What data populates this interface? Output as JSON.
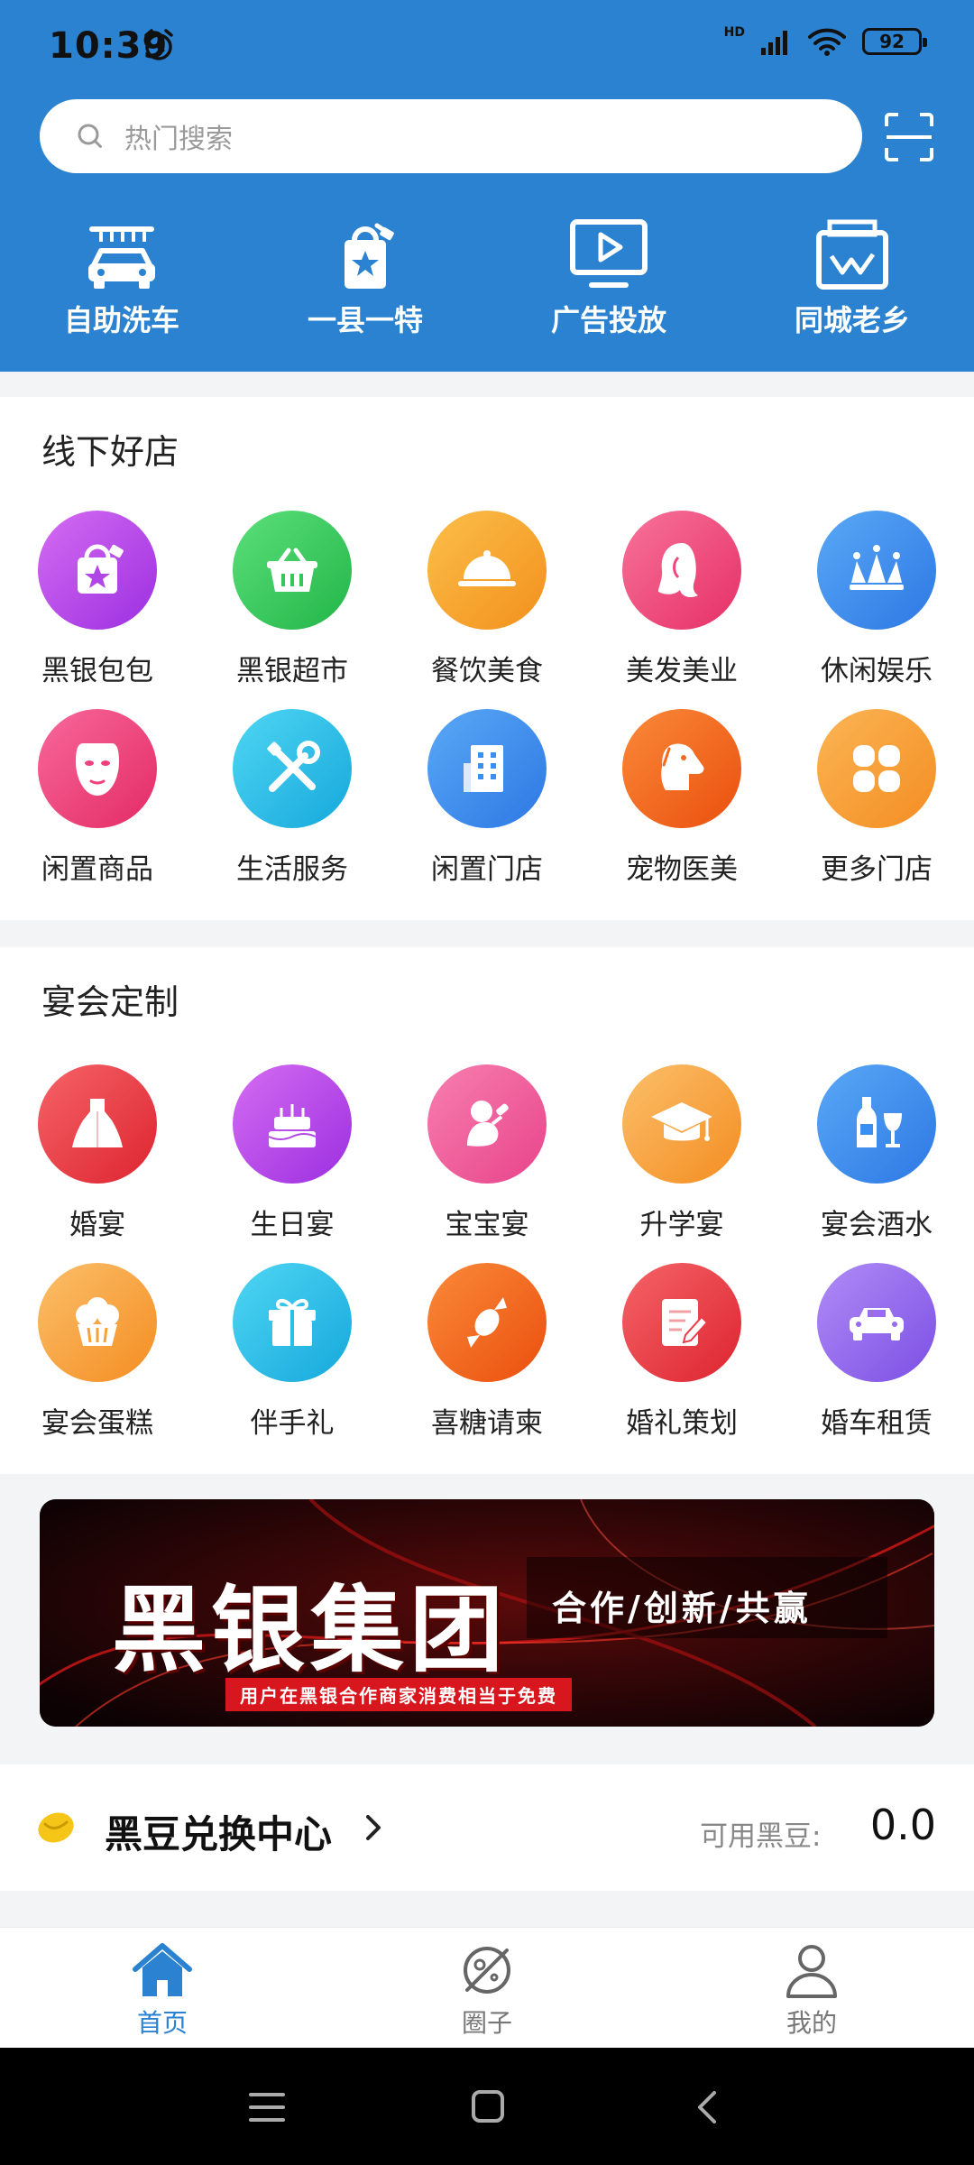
{
  "status_bar": {
    "time": "10:39",
    "network": "HD",
    "battery": "92"
  },
  "search": {
    "placeholder": "热门搜索"
  },
  "quick_actions": [
    {
      "label": "自助洗车",
      "icon": "car-wash-icon"
    },
    {
      "label": "一县一特",
      "icon": "shopping-bag-star-icon"
    },
    {
      "label": "广告投放",
      "icon": "tv-play-icon"
    },
    {
      "label": "同城老乡",
      "icon": "map-icon"
    }
  ],
  "offline_stores": {
    "title": "线下好店",
    "items": [
      {
        "label": "黑银包包",
        "icon": "bag-icon",
        "color": "#b146e6"
      },
      {
        "label": "黑银超市",
        "icon": "basket-icon",
        "color": "#35c65a"
      },
      {
        "label": "餐饮美食",
        "icon": "food-cloche-icon",
        "color": "#f7a12b"
      },
      {
        "label": "美发美业",
        "icon": "hair-icon",
        "color": "#f0457a"
      },
      {
        "label": "休闲娱乐",
        "icon": "crown-icon",
        "color": "#3b8ff0"
      },
      {
        "label": "闲置商品",
        "icon": "mask-icon",
        "color": "#f0407e"
      },
      {
        "label": "生活服务",
        "icon": "tools-icon",
        "color": "#27c0e8"
      },
      {
        "label": "闲置门店",
        "icon": "building-icon",
        "color": "#3b8ff0"
      },
      {
        "label": "宠物医美",
        "icon": "pet-icon",
        "color": "#f56a1e"
      },
      {
        "label": "更多门店",
        "icon": "more-icon",
        "color": "#f8a034"
      }
    ]
  },
  "banquet": {
    "title": "宴会定制",
    "items": [
      {
        "label": "婚宴",
        "icon": "wedding-dress-icon",
        "color": "#ec3b45"
      },
      {
        "label": "生日宴",
        "icon": "cake-icon",
        "color": "#b146e6"
      },
      {
        "label": "宝宝宴",
        "icon": "baby-icon",
        "color": "#f0457a"
      },
      {
        "label": "升学宴",
        "icon": "graduation-cap-icon",
        "color": "#f8a034"
      },
      {
        "label": "宴会酒水",
        "icon": "wine-icon",
        "color": "#3b8ff0"
      },
      {
        "label": "宴会蛋糕",
        "icon": "cupcake-icon",
        "color": "#f8a034"
      },
      {
        "label": "伴手礼",
        "icon": "gift-icon",
        "color": "#27c0e8"
      },
      {
        "label": "喜糖请柬",
        "icon": "candy-icon",
        "color": "#f56a1e"
      },
      {
        "label": "婚礼策划",
        "icon": "plan-note-icon",
        "color": "#ec3b45"
      },
      {
        "label": "婚车租赁",
        "icon": "car-icon",
        "color": "#9a6cf0"
      }
    ]
  },
  "banner": {
    "title": "黑银集团",
    "slogan": "合作/创新/共赢",
    "subtitle": "用户在黑银合作商家消费相当于免费"
  },
  "points": {
    "title": "黑豆兑换中心",
    "available_label": "可用黑豆:",
    "value": "0.0"
  },
  "tabs": [
    {
      "label": "首页",
      "icon": "home-icon",
      "active": true
    },
    {
      "label": "圈子",
      "icon": "planet-icon",
      "active": false
    },
    {
      "label": "我的",
      "icon": "user-icon",
      "active": false
    }
  ],
  "colors": {
    "header_blue": "#2b82d0",
    "accent": "#2b82d0"
  }
}
